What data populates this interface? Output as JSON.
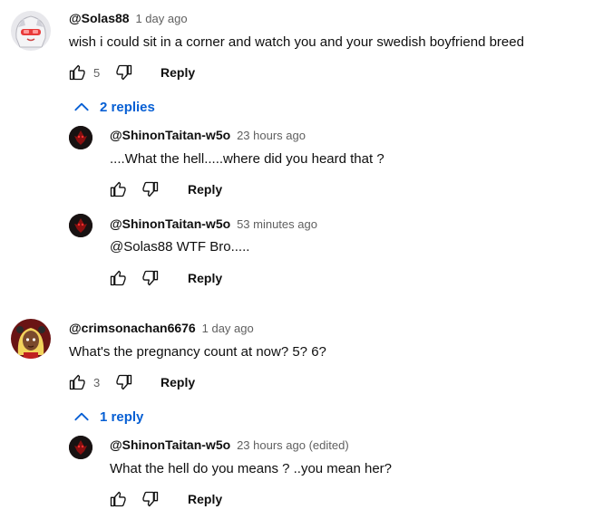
{
  "comments": [
    {
      "author": "@Solas88",
      "time": "1 day ago",
      "text": "wish i could sit in a corner and watch you and your swedish boyfriend breed",
      "likes": "5",
      "reply_label": "Reply",
      "replies_toggle": "2 replies",
      "replies": [
        {
          "author": "@ShinonTaitan-w5o",
          "time": "23 hours ago",
          "text": "....What the hell.....where did you heard that ?",
          "reply_label": "Reply"
        },
        {
          "author": "@ShinonTaitan-w5o",
          "time": "53 minutes ago",
          "text": "@Solas88 WTF Bro.....",
          "reply_label": "Reply"
        }
      ]
    },
    {
      "author": "@crimsonachan6676",
      "time": "1 day ago",
      "text": "What's the pregnancy count at now? 5? 6?",
      "likes": "3",
      "reply_label": "Reply",
      "replies_toggle": "1 reply",
      "replies": [
        {
          "author": "@ShinonTaitan-w5o",
          "time": "23 hours ago (edited)",
          "text": "What the hell do you means ? ..you mean her?",
          "reply_label": "Reply"
        }
      ]
    }
  ],
  "colors": {
    "link_blue": "#065fd4",
    "meta_gray": "#606060",
    "text": "#0f0f0f"
  }
}
